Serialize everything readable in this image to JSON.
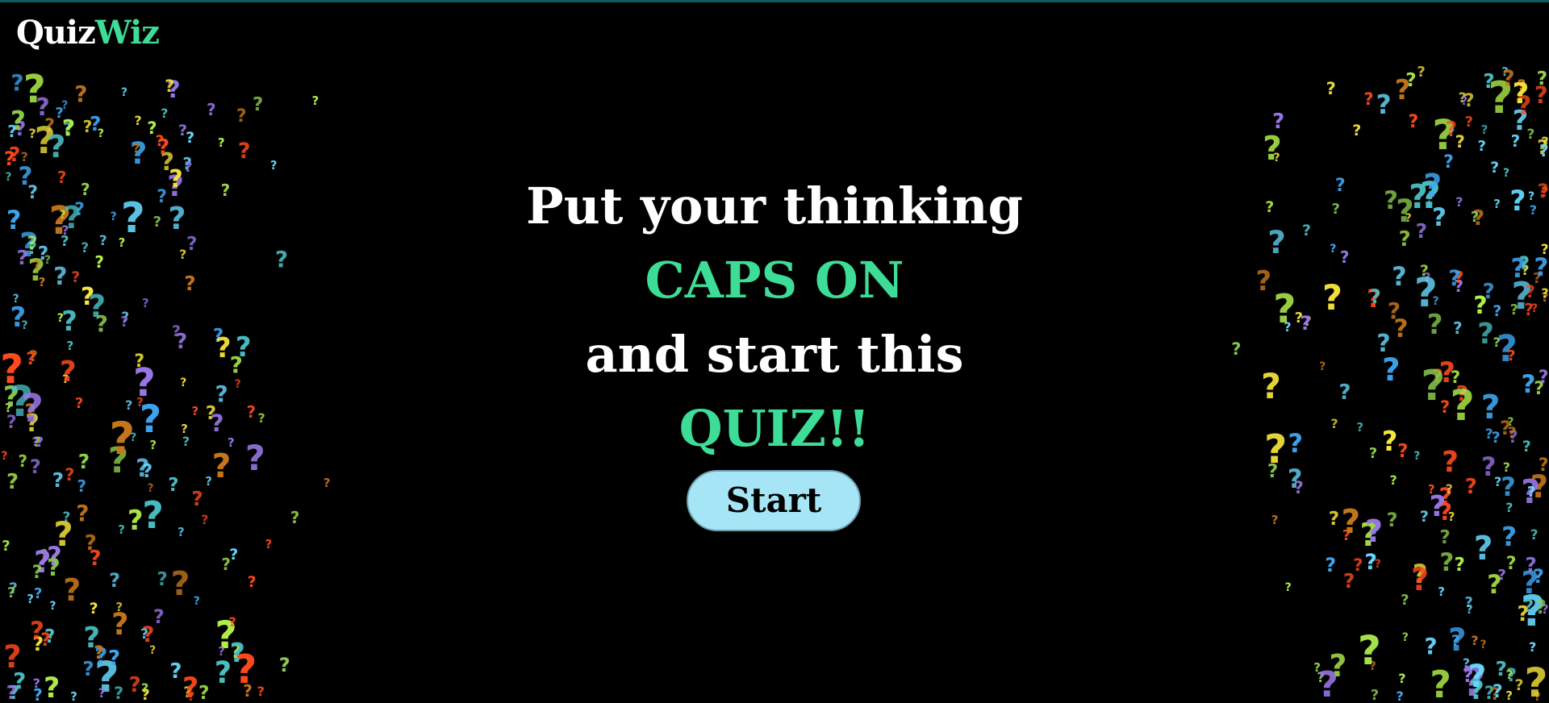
{
  "header": {
    "logo_part1": "Quiz",
    "logo_part2": "Wiz"
  },
  "hero": {
    "line1": "Put your thinking",
    "line2": "CAPS ON",
    "line3": "and start this",
    "line4": "QUIZ!!"
  },
  "start_button": {
    "label": "Start"
  },
  "colors": {
    "background": "#000000",
    "accent_green": "#3ddc97",
    "button_fill": "#a6e5f6",
    "top_bar": "#0a5f63",
    "question_mark_palette": [
      "#3fa9f5",
      "#b2f24c",
      "#f7e53b",
      "#9a78e8",
      "#ff4a1c",
      "#c8781c",
      "#4ac0c4",
      "#8fd14f",
      "#67d9ff"
    ]
  },
  "background": {
    "decoration_glyph": "?"
  }
}
